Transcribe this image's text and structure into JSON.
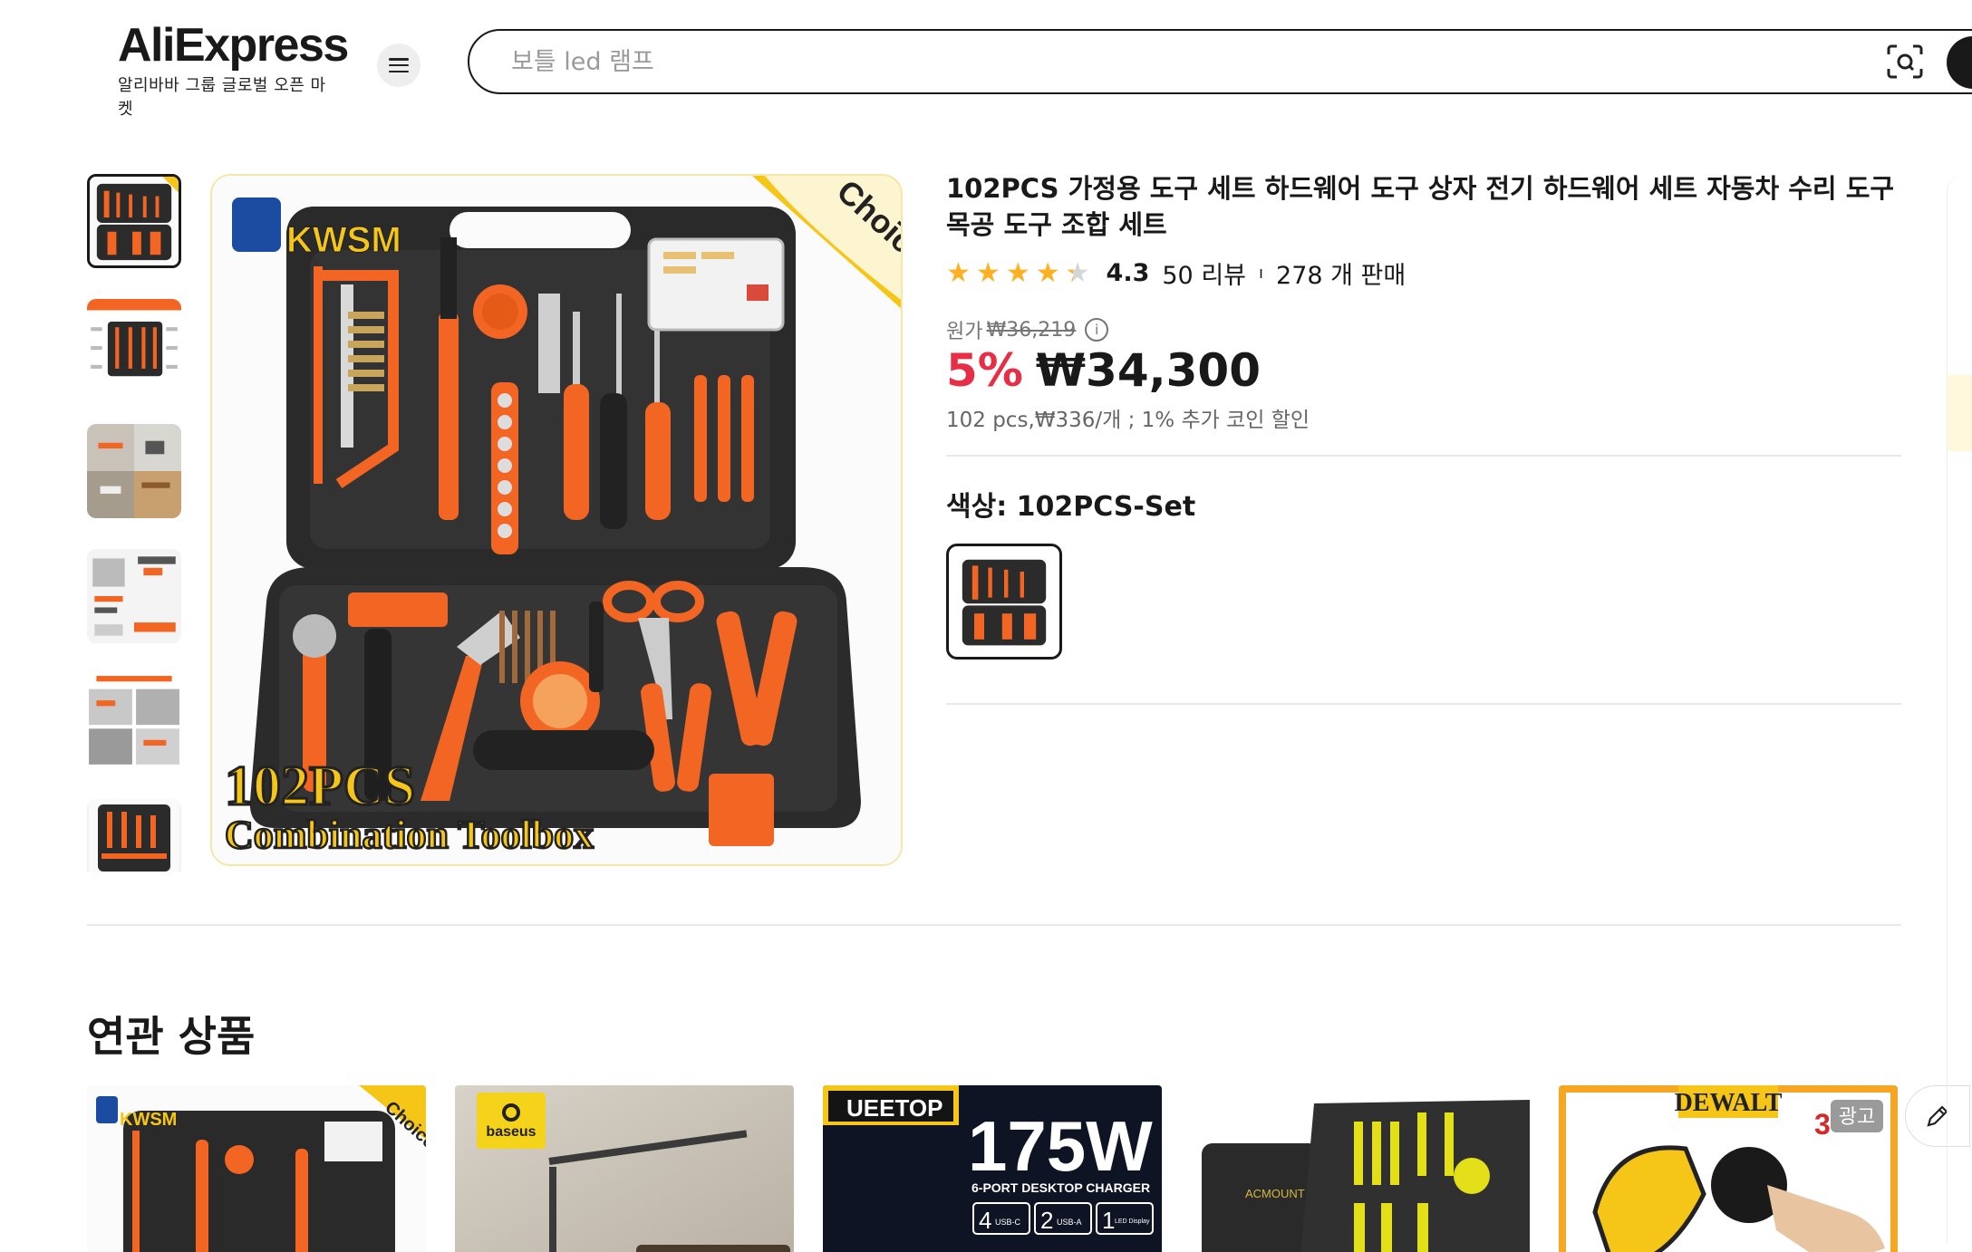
{
  "header": {
    "logo_text": "AliExpress",
    "logo_subtitle": "알리바바 그룹 글로벌 오픈 마켓",
    "menu_icon": "hamburger-icon",
    "search_placeholder": "보틀 led 램프",
    "camera_icon": "camera-search-icon"
  },
  "product": {
    "title": "102PCS 가정용 도구 세트 하드웨어 도구 상자 전기 하드웨어 세트 자동차 수리 도구 목공 도구 조합 세트",
    "rating": "4.3",
    "stars": 4.3,
    "reviews": "50 리뷰",
    "sold": "278 개 판매",
    "original_label": "원가",
    "original_price": "₩36,219",
    "discount": "5%",
    "price": "₩34,300",
    "unit_note": "102 pcs,₩336/개 ; 1% 추가 코인 할인",
    "color_label": "색상: 102PCS-Set",
    "image_badge": "Choice",
    "image_brand": "KWSM",
    "image_caption_1": "102PCS",
    "image_caption_2": "Combination Toolbox"
  },
  "related": {
    "title": "연관 상품",
    "cards": [
      {
        "badge": "Choice",
        "brand": "KWSM"
      },
      {
        "brand": "baseus"
      },
      {
        "brand": "UEETOP",
        "headline": "175W",
        "sub": "6-PORT DESKTOP CHARGER",
        "ports": [
          "4",
          "USB-C",
          "2",
          "USB-A",
          "1",
          "LED Display"
        ]
      },
      {
        "brand": "ACMOUNT"
      },
      {
        "brand": "DEWALT",
        "ad_label": "광고",
        "num": "3"
      }
    ]
  },
  "colors": {
    "accent_red": "#e62e46",
    "star": "#fdb022",
    "tool_orange": "#f26522",
    "case_dark": "#2b2b2b",
    "choice_gold": "#f5c518"
  }
}
